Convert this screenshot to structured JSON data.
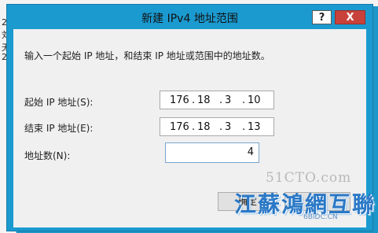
{
  "dialog": {
    "title": "新建 IPv4 地址范围",
    "help_label": "?",
    "close_label": "X",
    "instruction": "输入一个起始 IP 地址，和结束 IP 地址或范围中的地址数。",
    "start_ip_label": "起始 IP 地址(S):",
    "start_ip": [
      "176",
      "18",
      "3",
      "10"
    ],
    "end_ip_label": "结束 IP 地址(E):",
    "end_ip": [
      "176",
      "18",
      "3",
      "13"
    ],
    "count_label": "地址数(N):",
    "count_value": "4",
    "ok_label": "确定",
    "cancel_label": "取消"
  },
  "background": {
    "fragments": [
      "2",
      "刘",
      "无",
      "2"
    ]
  },
  "watermark": {
    "line1": "51CTO.com",
    "line2": "江蘇鴻網互聯",
    "line3": "6BIDC.CN"
  },
  "colors": {
    "frame": "#1b9ad0",
    "close": "#c8423b",
    "client": "#f0f0f0"
  }
}
